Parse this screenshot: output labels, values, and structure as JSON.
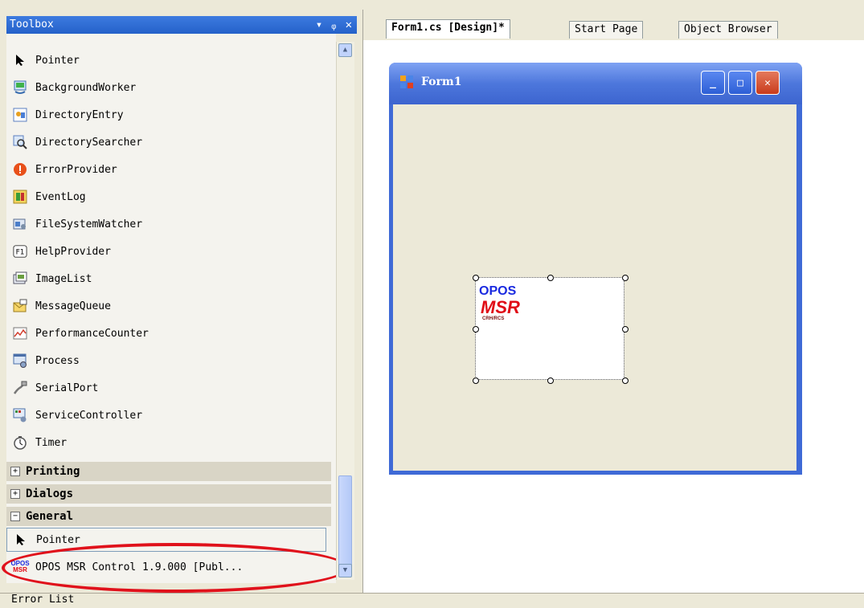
{
  "toolbox": {
    "title": "Toolbox",
    "controls": {
      "dropdown": "▾",
      "pin": "ᵩ",
      "close": "✕"
    },
    "components": [
      {
        "label": "Pointer",
        "icon": "pointer-icon"
      },
      {
        "label": "BackgroundWorker",
        "icon": "background-worker-icon"
      },
      {
        "label": "DirectoryEntry",
        "icon": "directory-entry-icon"
      },
      {
        "label": "DirectorySearcher",
        "icon": "directory-searcher-icon"
      },
      {
        "label": "ErrorProvider",
        "icon": "error-provider-icon"
      },
      {
        "label": "EventLog",
        "icon": "event-log-icon"
      },
      {
        "label": "FileSystemWatcher",
        "icon": "file-system-watcher-icon"
      },
      {
        "label": "HelpProvider",
        "icon": "help-provider-icon"
      },
      {
        "label": "ImageList",
        "icon": "image-list-icon"
      },
      {
        "label": "MessageQueue",
        "icon": "message-queue-icon"
      },
      {
        "label": "PerformanceCounter",
        "icon": "performance-counter-icon"
      },
      {
        "label": "Process",
        "icon": "process-icon"
      },
      {
        "label": "SerialPort",
        "icon": "serial-port-icon"
      },
      {
        "label": "ServiceController",
        "icon": "service-controller-icon"
      },
      {
        "label": "Timer",
        "icon": "timer-icon"
      }
    ],
    "categories": {
      "printing": {
        "label": "Printing",
        "sign": "+"
      },
      "dialogs": {
        "label": "Dialogs",
        "sign": "+"
      },
      "general": {
        "label": "General",
        "sign": "−"
      }
    },
    "general_items": {
      "pointer": "Pointer",
      "opos": "OPOS MSR Control 1.9.000 [Publ...",
      "opos_icon_top": "OPOS",
      "opos_icon_bottom": "MSR"
    }
  },
  "designer": {
    "tabs": {
      "form_design": "Form1.cs [Design]*",
      "start_page": "Start Page",
      "object_browser": "Object Browser"
    },
    "form": {
      "title": "Form1",
      "minimize": "_",
      "maximize": "□",
      "close": "✕"
    },
    "opos_control": {
      "logo_top": "OPOS",
      "logo_middle": "MSR",
      "logo_bottom": "CRH/RCS"
    }
  },
  "status": {
    "error_list": "Error List"
  },
  "colors": {
    "title_blue": "#2461c9",
    "form_blue": "#3f6ad6",
    "highlight_red": "#e0111b",
    "panel_beige": "#ece9d8"
  }
}
